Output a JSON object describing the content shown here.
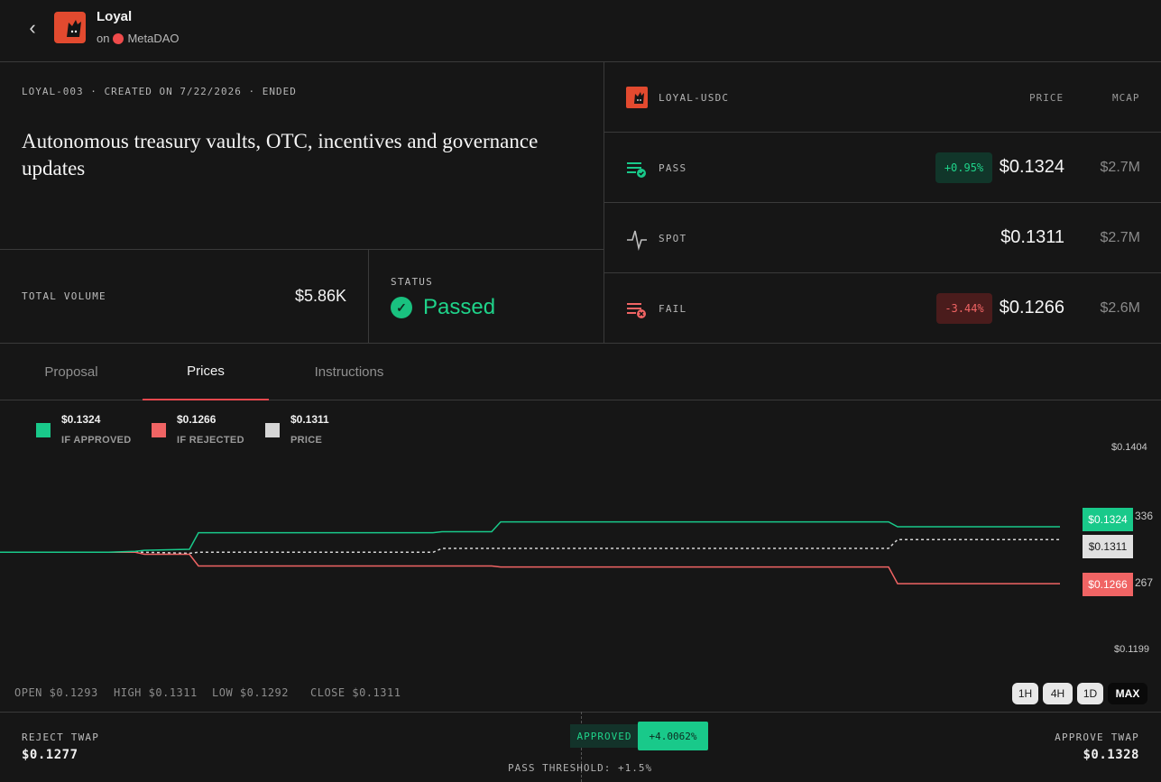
{
  "header": {
    "back_icon": "chevron-left-icon",
    "app_name": "Loyal",
    "on_label": "on",
    "platform": "MetaDAO"
  },
  "proposal": {
    "meta_line": "LOYAL-003 · CREATED ON 7/22/2026 · ENDED",
    "title": "Autonomous treasury vaults, OTC, incentives and governance updates",
    "total_volume_label": "TOTAL VOLUME",
    "total_volume": "$5.86K",
    "status_label": "STATUS",
    "status": "Passed"
  },
  "market": {
    "pair": "LOYAL-USDC",
    "price_header": "PRICE",
    "mcap_header": "MCAP",
    "rows": [
      {
        "label": "PASS",
        "change": "+0.95%",
        "price": "$0.1324",
        "mcap": "$2.7M",
        "icon": "pass-list-icon"
      },
      {
        "label": "SPOT",
        "change": "",
        "price": "$0.1311",
        "mcap": "$2.7M",
        "icon": "pulse-icon"
      },
      {
        "label": "FAIL",
        "change": "-3.44%",
        "price": "$0.1266",
        "mcap": "$2.6M",
        "icon": "fail-list-icon"
      }
    ]
  },
  "tabs": [
    {
      "label": "Proposal",
      "active": false
    },
    {
      "label": "Prices",
      "active": true
    },
    {
      "label": "Instructions",
      "active": false
    }
  ],
  "colors": {
    "approved": "#19c98a",
    "rejected": "#f06464",
    "spot": "#d6d6d6",
    "accent_red": "#e5484d"
  },
  "chart_data": {
    "type": "line",
    "legend": [
      {
        "value": "$0.1324",
        "label": "IF APPROVED"
      },
      {
        "value": "$0.1266",
        "label": "IF REJECTED"
      },
      {
        "value": "$0.1311",
        "label": "PRICE"
      }
    ],
    "ylim": [
      0.1199,
      0.1404
    ],
    "y_ticks": [
      "$0.1404",
      "$0.1199"
    ],
    "x": [
      0,
      40,
      80,
      120,
      150,
      160,
      210,
      220,
      480,
      490,
      545,
      555,
      985,
      995,
      1175
    ],
    "series": [
      {
        "name": "IF APPROVED",
        "values": [
          0.1298,
          0.1298,
          0.1298,
          0.1298,
          0.1299,
          0.13,
          0.1301,
          0.1318,
          0.1318,
          0.1319,
          0.1319,
          0.1329,
          0.1329,
          0.1324,
          0.1324
        ]
      },
      {
        "name": "IF REJECTED",
        "values": [
          0.1298,
          0.1298,
          0.1298,
          0.1298,
          0.1298,
          0.1296,
          0.1296,
          0.1284,
          0.1284,
          0.1284,
          0.1284,
          0.1283,
          0.1283,
          0.1266,
          0.1266
        ]
      },
      {
        "name": "PRICE",
        "values": [
          0.1298,
          0.1298,
          0.1298,
          0.1298,
          0.1298,
          0.1298,
          0.1297,
          0.1298,
          0.1298,
          0.1302,
          0.1302,
          0.1302,
          0.1302,
          0.1311,
          0.1311
        ]
      }
    ],
    "tags": {
      "approved": "$0.1324",
      "spot": "$0.1311",
      "rejected": "$0.1266"
    },
    "side_ticks": {
      "upper": "336",
      "lower": "267"
    },
    "grid": false
  },
  "ohlc": {
    "open_label": "OPEN",
    "open": "$0.1293",
    "high_label": "HIGH",
    "high": "$0.1311",
    "low_label": "LOW",
    "low": "$0.1292",
    "close_label": "CLOSE",
    "close": "$0.1311"
  },
  "timeframes": [
    {
      "label": "1H",
      "active": false
    },
    {
      "label": "4H",
      "active": false
    },
    {
      "label": "1D",
      "active": false
    },
    {
      "label": "MAX",
      "active": true
    }
  ],
  "footer": {
    "reject_twap_label": "REJECT TWAP",
    "reject_twap": "$0.1277",
    "approved_label": "APPROVED",
    "approved_delta": "+4.0062%",
    "threshold": "PASS THRESHOLD: +1.5%",
    "approve_twap_label": "APPROVE TWAP",
    "approve_twap": "$0.1328"
  }
}
